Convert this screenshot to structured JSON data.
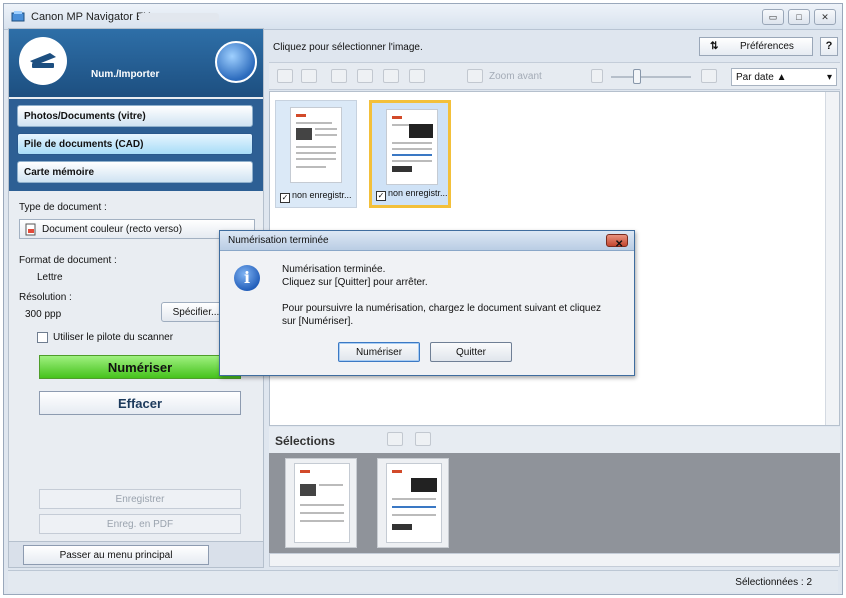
{
  "window": {
    "title": "Canon MP Navigator EX",
    "controls": {
      "minimize": "▭",
      "maximize": "□",
      "close": "✕"
    }
  },
  "left_panel": {
    "mode_title": "Num./Importer",
    "nav": [
      {
        "label": "Photos/Documents (vitre)"
      },
      {
        "label": "Pile de documents (CAD)"
      },
      {
        "label": "Carte mémoire"
      }
    ],
    "doc_type_label": "Type de document :",
    "doc_type_value": "Document couleur (recto verso)",
    "format_label": "Format de document :",
    "format_value": "Lettre",
    "resolution_label": "Résolution :",
    "resolution_value": "300 ppp",
    "specify_button": "Spécifier...",
    "driver_checkbox": "Utiliser le pilote du scanner",
    "scan_button": "Numériser",
    "clear_button": "Effacer",
    "save_button": "Enregistrer",
    "save_pdf_button": "Enreg. en PDF",
    "main_menu_button": "Passer au menu principal"
  },
  "right_panel": {
    "instruction": "Cliquez pour sélectionner l'image.",
    "preferences_button": "Préférences",
    "help_button": "?",
    "zoom_label": "Zoom avant",
    "sort_value": "Par date ▲",
    "thumbnails": [
      {
        "caption": "non enregistr...",
        "checked": true,
        "selected": false
      },
      {
        "caption": "non enregistr...",
        "checked": true,
        "selected": true
      }
    ],
    "selections_title": "Sélections",
    "status": "Sélectionnées : 2"
  },
  "dialog": {
    "title": "Numérisation terminée",
    "line1": "Numérisation terminée.",
    "line2": "Cliquez sur [Quitter] pour arrêter.",
    "line3": "Pour poursuivre la numérisation, chargez le document suivant et cliquez",
    "line4": "sur [Numériser].",
    "scan_button": "Numériser",
    "quit_button": "Quitter"
  },
  "colors": {
    "header_blue": "#1d4f80",
    "scan_green": "#46c31c",
    "selection_gold": "#f3c03a",
    "dialog_close_red": "#c34730"
  }
}
